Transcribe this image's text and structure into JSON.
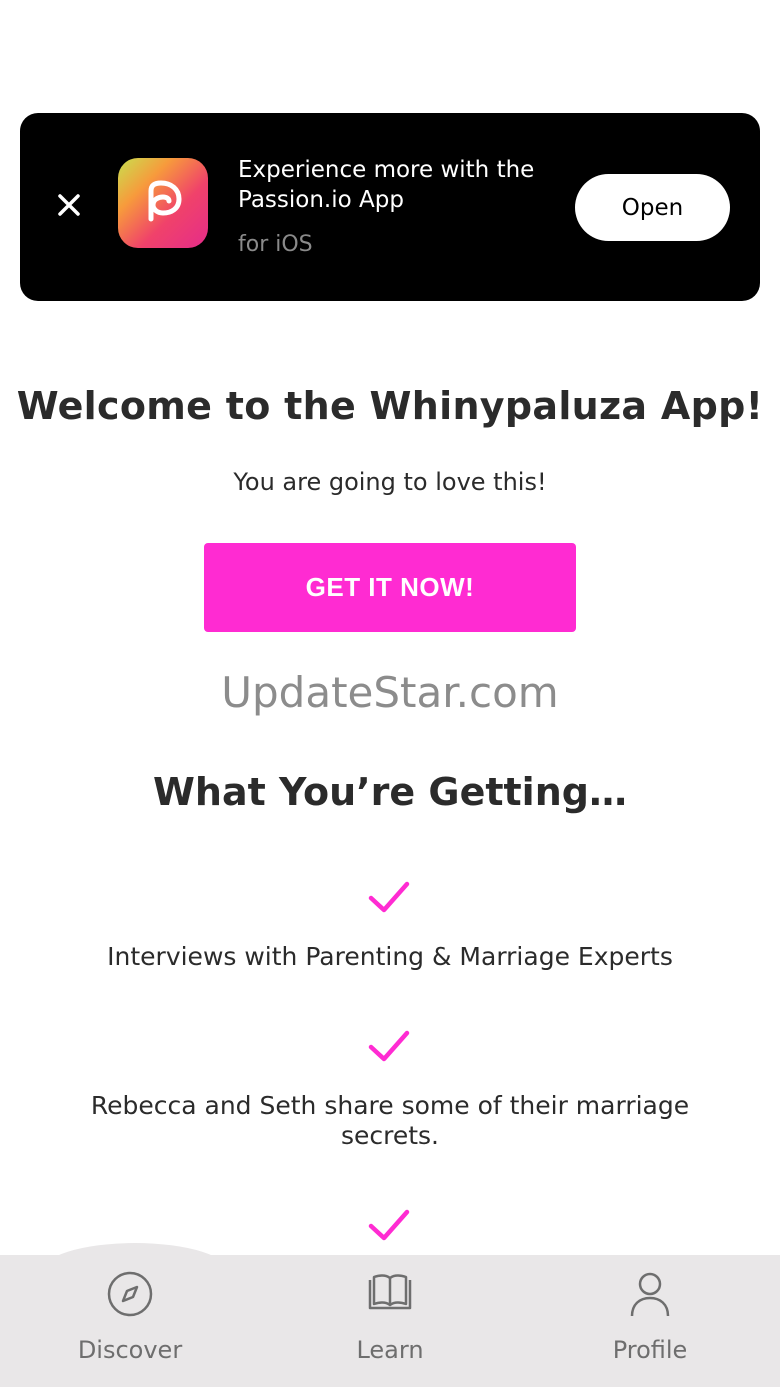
{
  "banner": {
    "title": "Experience more with the Passion.io App",
    "subtitle": "for iOS",
    "open_label": "Open",
    "close_icon": "close-icon",
    "app_icon": "passion-app-icon"
  },
  "main": {
    "headline": "Welcome to the Whinypaluza App!",
    "subheadline": "You are going to love this!",
    "cta_label": "GET IT NOW!",
    "watermark": "UpdateStar.com",
    "section_title": "What You’re Getting…",
    "features": [
      {
        "icon": "check-icon",
        "text": "Interviews with Parenting & Marriage Experts"
      },
      {
        "icon": "check-icon",
        "text": "Rebecca and Seth share some of their marriage secrets."
      },
      {
        "icon": "check-icon",
        "text": ""
      }
    ]
  },
  "tabbar": {
    "items": [
      {
        "icon": "compass-icon",
        "label": "Discover"
      },
      {
        "icon": "book-icon",
        "label": "Learn"
      },
      {
        "icon": "person-icon",
        "label": "Profile"
      }
    ]
  },
  "colors": {
    "accent": "#ff2bd2",
    "banner_bg": "#000000",
    "tabbar_bg": "#e9e7e8",
    "text": "#2b2b2b"
  }
}
